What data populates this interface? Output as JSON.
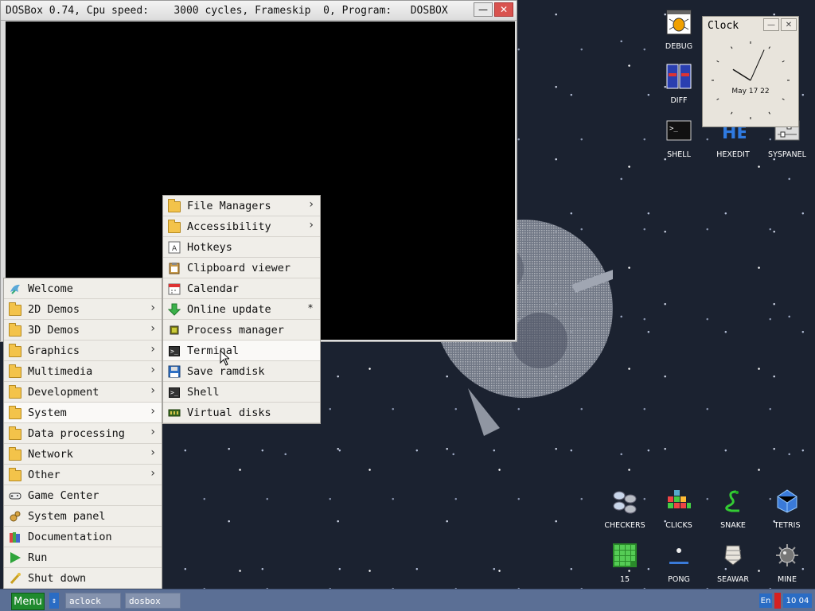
{
  "dosbox": {
    "title": "DOSBox 0.74, Cpu speed:    3000 cycles, Frameskip  0, Program:   DOSBOX",
    "minimize_icon": "minimize-icon",
    "close_icon": "close-icon"
  },
  "start_menu": {
    "items": [
      {
        "label": "Welcome",
        "icon": "welcome-bird-icon",
        "submenu": false
      },
      {
        "label": "2D Demos",
        "icon": "folder-icon",
        "submenu": true
      },
      {
        "label": "3D Demos",
        "icon": "folder-icon",
        "submenu": true
      },
      {
        "label": "Graphics",
        "icon": "folder-icon",
        "submenu": true
      },
      {
        "label": "Multimedia",
        "icon": "folder-icon",
        "submenu": true
      },
      {
        "label": "Development",
        "icon": "folder-icon",
        "submenu": true
      },
      {
        "label": "System",
        "icon": "folder-icon",
        "submenu": true,
        "highlighted": true
      },
      {
        "label": "Data processing",
        "icon": "folder-icon",
        "submenu": true
      },
      {
        "label": "Network",
        "icon": "folder-icon",
        "submenu": true
      },
      {
        "label": "Other",
        "icon": "folder-icon",
        "submenu": true
      },
      {
        "label": "Game Center",
        "icon": "gamepad-icon",
        "submenu": false
      },
      {
        "label": "System panel",
        "icon": "gears-icon",
        "submenu": false
      },
      {
        "label": "Documentation",
        "icon": "books-icon",
        "submenu": false
      },
      {
        "label": "Run",
        "icon": "play-icon",
        "submenu": false
      },
      {
        "label": "Shut down",
        "icon": "shutdown-icon",
        "submenu": false
      }
    ]
  },
  "system_submenu": {
    "items": [
      {
        "label": "File Managers",
        "icon": "folder-icon",
        "submenu": true
      },
      {
        "label": "Accessibility",
        "icon": "folder-icon",
        "submenu": true
      },
      {
        "label": "Hotkeys",
        "icon": "keyboard-key-icon"
      },
      {
        "label": "Clipboard viewer",
        "icon": "clipboard-icon"
      },
      {
        "label": "Calendar",
        "icon": "calendar-icon"
      },
      {
        "label": "Online update",
        "icon": "download-arrow-icon",
        "mark": "*"
      },
      {
        "label": "Process manager",
        "icon": "chip-icon"
      },
      {
        "label": "Terminal",
        "icon": "terminal-icon",
        "highlighted": true
      },
      {
        "label": "Save ramdisk",
        "icon": "floppy-icon"
      },
      {
        "label": "Shell",
        "icon": "terminal-icon"
      },
      {
        "label": "Virtual disks",
        "icon": "memory-icon"
      }
    ]
  },
  "desktop_icons": {
    "debug": "DEBUG",
    "diff": "DIFF",
    "shell": "SHELL",
    "hexedit": "HEXEDIT",
    "syspanel": "SYSPANEL",
    "partial_k": "K",
    "checkers": "CHECKERS",
    "clicks": "CLICKS",
    "snake": "SNAKE",
    "tetris": "TETRIS",
    "fifteen": "15",
    "pong": "PONG",
    "seawar": "SEAWAR",
    "mine": "MINE"
  },
  "clock": {
    "title": "Clock",
    "date": "May 17 22",
    "time_hours": 10,
    "time_minutes": 4
  },
  "taskbar": {
    "menu_label": "Menu",
    "tasks": [
      "aclock",
      "dosbox"
    ],
    "language": "En",
    "time": "10 04"
  },
  "colors": {
    "desktop_bg": "#1b2230",
    "taskbar_bg": "#5b6f95",
    "menu_button": "#1f8a2e",
    "accent_blue": "#2a6cc4",
    "alert_red": "#d62020"
  }
}
